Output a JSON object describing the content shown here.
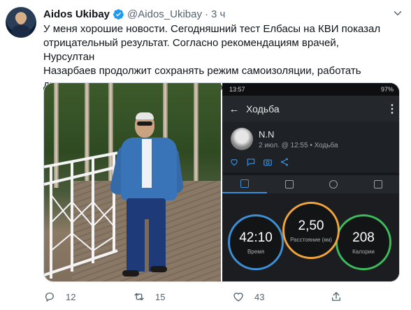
{
  "tweet": {
    "author_name": "Aidos Ukibay",
    "author_handle": "@Aidos_Ukibay",
    "separator": "·",
    "time": "3 ч",
    "text": "У меня хорошие новости. Сегодняшний тест Елбасы на КВИ показал\nотрицательный результат. Согласно рекомендациям врачей, Нурсултан\nНазарбаев продолжит сохранять режим самоизоляции, работать\nдистанционно и уделять время прогулкам на свежем воздухе."
  },
  "phone": {
    "status_time": "13:57",
    "status_battery": "97%",
    "app_title": "Ходьба",
    "activity_user": "N.N",
    "activity_meta": "2 июл. @ 12:55 • Ходьба",
    "stats": {
      "time_value": "42:10",
      "time_label": "Время",
      "distance_value": "2,50",
      "distance_label": "Расстояние (км)",
      "calories_value": "208",
      "calories_label": "Калории"
    }
  },
  "actions": {
    "replies": "12",
    "retweets": "15",
    "likes": "43"
  },
  "colors": {
    "verified": "#1d9bf0",
    "secondary_text": "#536471",
    "ring_time": "#3d8fd6",
    "ring_distance": "#f1a33c",
    "ring_calories": "#3dbb5c"
  }
}
